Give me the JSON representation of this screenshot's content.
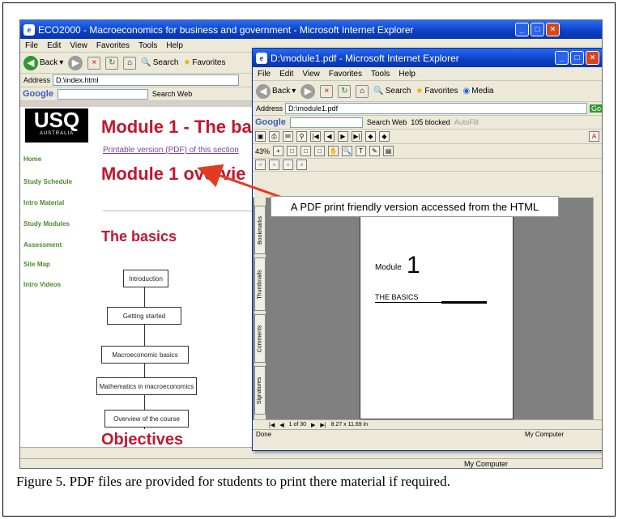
{
  "ie": {
    "title": "ECO2000 - Macroeconomics for business and government - Microsoft Internet Explorer",
    "menu": [
      "File",
      "Edit",
      "View",
      "Favorites",
      "Tools",
      "Help"
    ],
    "back_label": "Back",
    "search_label": "Search",
    "favorites_label": "Favorites",
    "address_label": "Address",
    "address_value": "D:\\index.html",
    "google_label": "Google",
    "search_web_label": "Search Web",
    "status_computer": "My Computer"
  },
  "site": {
    "logo": "USQ",
    "logo_sub": "AUSTRALIA",
    "nav": [
      "Home",
      "Study Schedule",
      "Intro Material",
      "Study Modules",
      "Assessment",
      "Site Map",
      "Intro Videos"
    ],
    "module_title": "Module 1 - The ba",
    "pdf_link": "Printable version (PDF) of this section",
    "overview_title": "Module 1 overvie",
    "basics_title": "The basics",
    "flow": [
      "Introduction",
      "Getting started",
      "Macroeconomic basics",
      "Mathematics in macroeconomics",
      "Overview of the course"
    ],
    "objectives_title": "Objectives"
  },
  "pdf": {
    "title": "D:\\module1.pdf - Microsoft Internet Explorer",
    "menu": [
      "File",
      "Edit",
      "View",
      "Favorites",
      "Tools",
      "Help"
    ],
    "back_label": "Back",
    "search_label": "Search",
    "favorites_label": "Favorites",
    "media_label": "Media",
    "address_label": "Address",
    "address_value": "D:\\module1.pdf",
    "go_label": "Go",
    "google_label": "Google",
    "search_web_label": "Search Web",
    "blocked_label": "105 blocked",
    "autofill_label": "AutoFill",
    "zoom": "43%",
    "tabs": [
      "Bookmarks",
      "Thumbnails",
      "Comments",
      "Signatures"
    ],
    "doc_module_word": "Module",
    "doc_module_num": "1",
    "doc_basics": "THE BASICS",
    "page_of": "1 of 30",
    "page_size": "8.27 x 11.69 in",
    "status_done": "Done",
    "status_computer": "My Computer"
  },
  "annotation": {
    "callout": "A PDF print friendly version accessed from the HTML"
  },
  "caption": "Figure 5. PDF files are provided for students to print there material if required."
}
